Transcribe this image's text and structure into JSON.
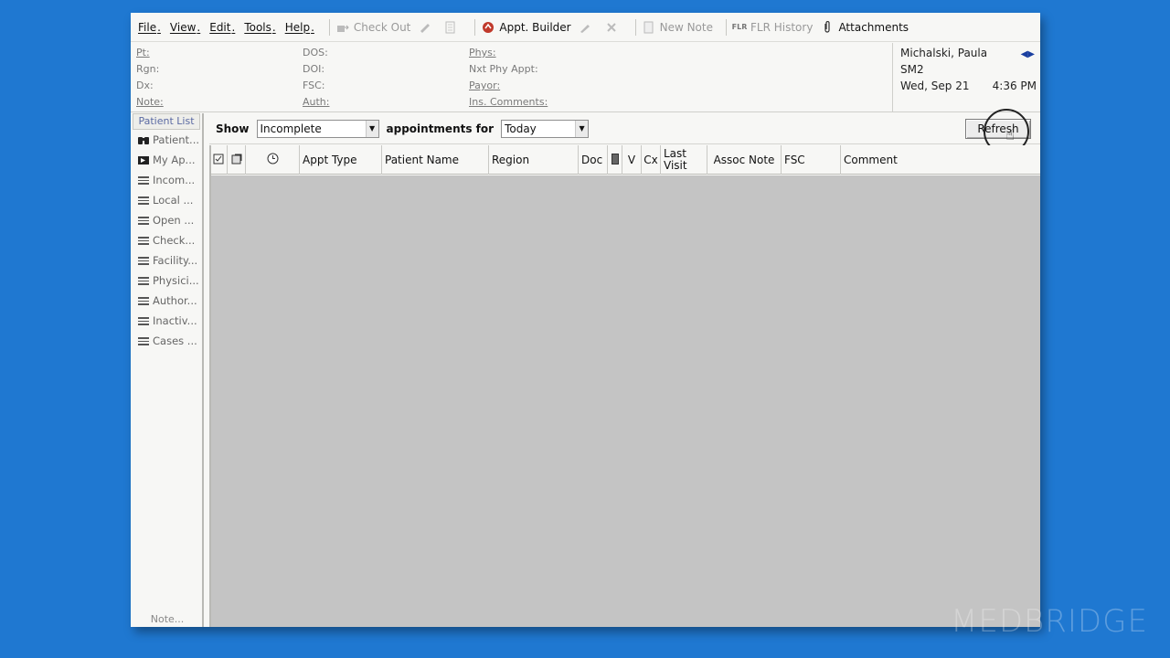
{
  "menu": [
    {
      "name": "menu-file",
      "label": "File"
    },
    {
      "name": "menu-view",
      "label": "View"
    },
    {
      "name": "menu-edit",
      "label": "Edit"
    },
    {
      "name": "menu-tools",
      "label": "Tools"
    },
    {
      "name": "menu-help",
      "label": "Help"
    }
  ],
  "toolbar": {
    "check_out": "Check Out",
    "appt_builder": "Appt. Builder",
    "new_note": "New Note",
    "flr_history": "FLR History",
    "flr_badge": "FLR",
    "attachments": "Attachments"
  },
  "info": {
    "col1": [
      "Pt:",
      "Rgn:",
      "Dx:",
      "Note:"
    ],
    "col2": [
      "DOS:",
      "DOI:",
      "FSC:",
      "Auth:"
    ],
    "col3": [
      "Phys:",
      "Nxt Phy Appt:",
      "Payor:",
      "Ins. Comments:"
    ],
    "user_name": "Michalski, Paula",
    "user_code": "SM2",
    "date": "Wed, Sep 21",
    "time": "4:36 PM"
  },
  "sidebar": {
    "title": "Patient List",
    "items": [
      {
        "label": "Patient...",
        "icon": "binoculars-icon"
      },
      {
        "label": "My Ap...",
        "icon": "my-appointments-icon"
      },
      {
        "label": "Incom...",
        "icon": "list-icon"
      },
      {
        "label": "Local ...",
        "icon": "list-icon"
      },
      {
        "label": "Open ...",
        "icon": "list-icon"
      },
      {
        "label": "Check...",
        "icon": "list-icon"
      },
      {
        "label": "Facility...",
        "icon": "list-icon"
      },
      {
        "label": "Physici...",
        "icon": "list-icon"
      },
      {
        "label": "Author...",
        "icon": "list-icon"
      },
      {
        "label": "Inactiv...",
        "icon": "list-icon"
      },
      {
        "label": "Cases ...",
        "icon": "list-icon"
      }
    ],
    "note": "Note..."
  },
  "filter": {
    "show_label": "Show",
    "status_value": "Incomplete",
    "appointments_for_label": "appointments for",
    "period_value": "Today",
    "refresh_label": "Refresh"
  },
  "grid": {
    "columns": [
      "Appt Type",
      "Patient Name",
      "Region",
      "Doc",
      "V",
      "Cx",
      "Last Visit",
      "Assoc Note",
      "FSC",
      "Comment"
    ]
  },
  "watermark": "MEDBRIDGE",
  "colors": {
    "desktop": "#1f78d1",
    "grid_body": "#c4c4c4"
  }
}
